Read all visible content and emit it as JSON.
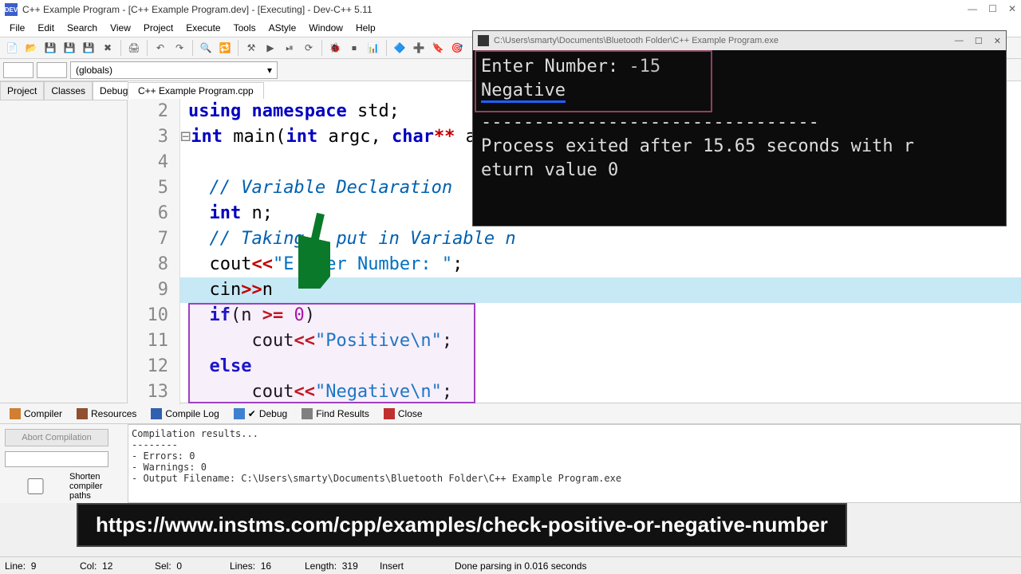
{
  "titlebar": {
    "text": "C++ Example Program - [C++ Example Program.dev] - [Executing] - Dev-C++ 5.11",
    "app_icon_label": "DEV"
  },
  "menu": [
    "File",
    "Edit",
    "Search",
    "View",
    "Project",
    "Execute",
    "Tools",
    "AStyle",
    "Window",
    "Help"
  ],
  "toolbar2": {
    "dropdown": "(globals)"
  },
  "side_tabs": [
    "Project",
    "Classes",
    "Debug"
  ],
  "file_tab": "C++ Example Program.cpp",
  "code": {
    "lines": [
      {
        "n": 2,
        "html": "<span class='kw'>using</span> <span class='kw'>namespace</span> std;"
      },
      {
        "n": 3,
        "html": "<span class='kw'>int</span> main(<span class='kw'>int</span> argc, <span class='kw'>char</span><span class='op'>**</span> ar",
        "fold": true
      },
      {
        "n": 4,
        "html": ""
      },
      {
        "n": 5,
        "html": "  <span class='cm'>// Variable Declaration</span>"
      },
      {
        "n": 6,
        "html": "  <span class='kw'>int</span> n;"
      },
      {
        "n": 7,
        "html": "  <span class='cm'>// Taking   put in Variable n</span>"
      },
      {
        "n": 8,
        "html": "  cout<span class='op'>&lt;&lt;</span><span class='str'>\"E  ter Number: \"</span>;"
      },
      {
        "n": 9,
        "html": "  cin<span class='op'>&gt;&gt;</span>n ",
        "hl": true
      },
      {
        "n": 10,
        "html": "  <span class='kw'>if</span>(n <span class='op'>&gt;=</span> <span class='num'>0</span>)"
      },
      {
        "n": 11,
        "html": "      cout<span class='op'>&lt;&lt;</span><span class='str'>\"Positive\\n\"</span>;"
      },
      {
        "n": 12,
        "html": "  <span class='kw'>else</span>"
      },
      {
        "n": 13,
        "html": "      cout<span class='op'>&lt;&lt;</span><span class='str'>\"Negative\\n\"</span>;"
      }
    ]
  },
  "console": {
    "title": "C:\\Users\\smarty\\Documents\\Bluetooth Folder\\C++ Example Program.exe",
    "line1_prompt": "Enter Number: ",
    "line1_input": "-15",
    "line2": "Negative",
    "dashes": "--------------------------------",
    "exit_line1": "Process exited after 15.65 seconds with r",
    "exit_line2": "eturn value 0"
  },
  "bottom_tabs": {
    "compiler": "Compiler",
    "resources": "Resources",
    "compile_log": "Compile Log",
    "debug": "Debug",
    "find_results": "Find Results",
    "close": "Close"
  },
  "bottom_panel": {
    "abort": "Abort Compilation",
    "shorten": "Shorten compiler paths",
    "log": "Compilation results...\n--------\n- Errors: 0\n- Warnings: 0\n- Output Filename: C:\\Users\\smarty\\Documents\\Bluetooth Folder\\C++ Example Program.exe"
  },
  "url": "https://www.instms.com/cpp/examples/check-positive-or-negative-number",
  "status": {
    "line_lbl": "Line:",
    "line": "9",
    "col_lbl": "Col:",
    "col": "12",
    "sel_lbl": "Sel:",
    "sel": "0",
    "lines_lbl": "Lines:",
    "lines": "16",
    "len_lbl": "Length:",
    "len": "319",
    "insert": "Insert",
    "parse": "Done parsing in 0.016 seconds"
  }
}
